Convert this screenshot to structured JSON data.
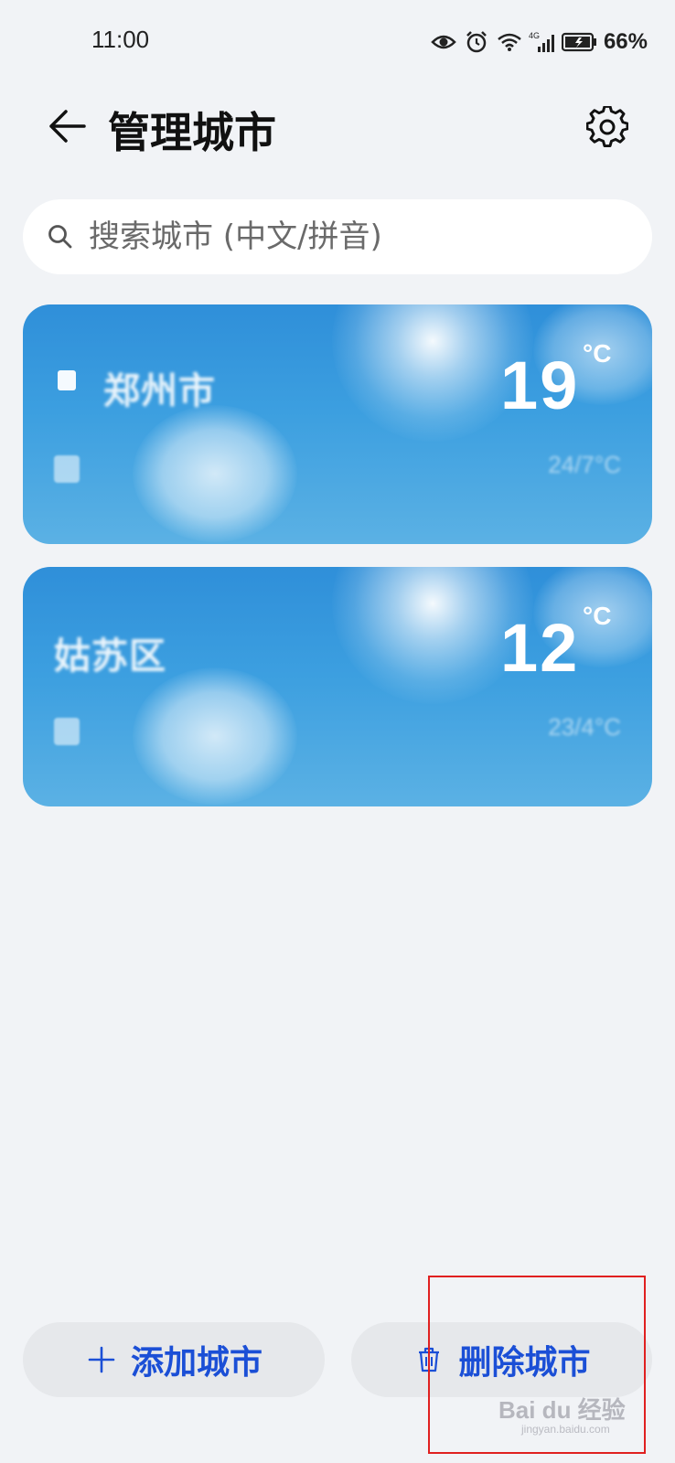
{
  "status_bar": {
    "time": "11:00",
    "network": "4G",
    "battery": "66%"
  },
  "header": {
    "title": "管理城市"
  },
  "search": {
    "placeholder": "搜索城市 (中文/拼音)"
  },
  "cities": [
    {
      "name": "郑州市",
      "temp": "19",
      "unit": "°C",
      "range": "24/7°C",
      "is_location": true
    },
    {
      "name": "姑苏区",
      "temp": "12",
      "unit": "°C",
      "range": "23/4°C",
      "is_location": false
    }
  ],
  "actions": {
    "add_label": "添加城市",
    "delete_label": "删除城市"
  },
  "watermark": {
    "text": "Bai du 经验",
    "sub": "jingyan.baidu.com"
  },
  "colors": {
    "background": "#f1f3f6",
    "accent": "#1b4fd6",
    "card": "#3c9fe0",
    "highlight": "#e02020"
  }
}
